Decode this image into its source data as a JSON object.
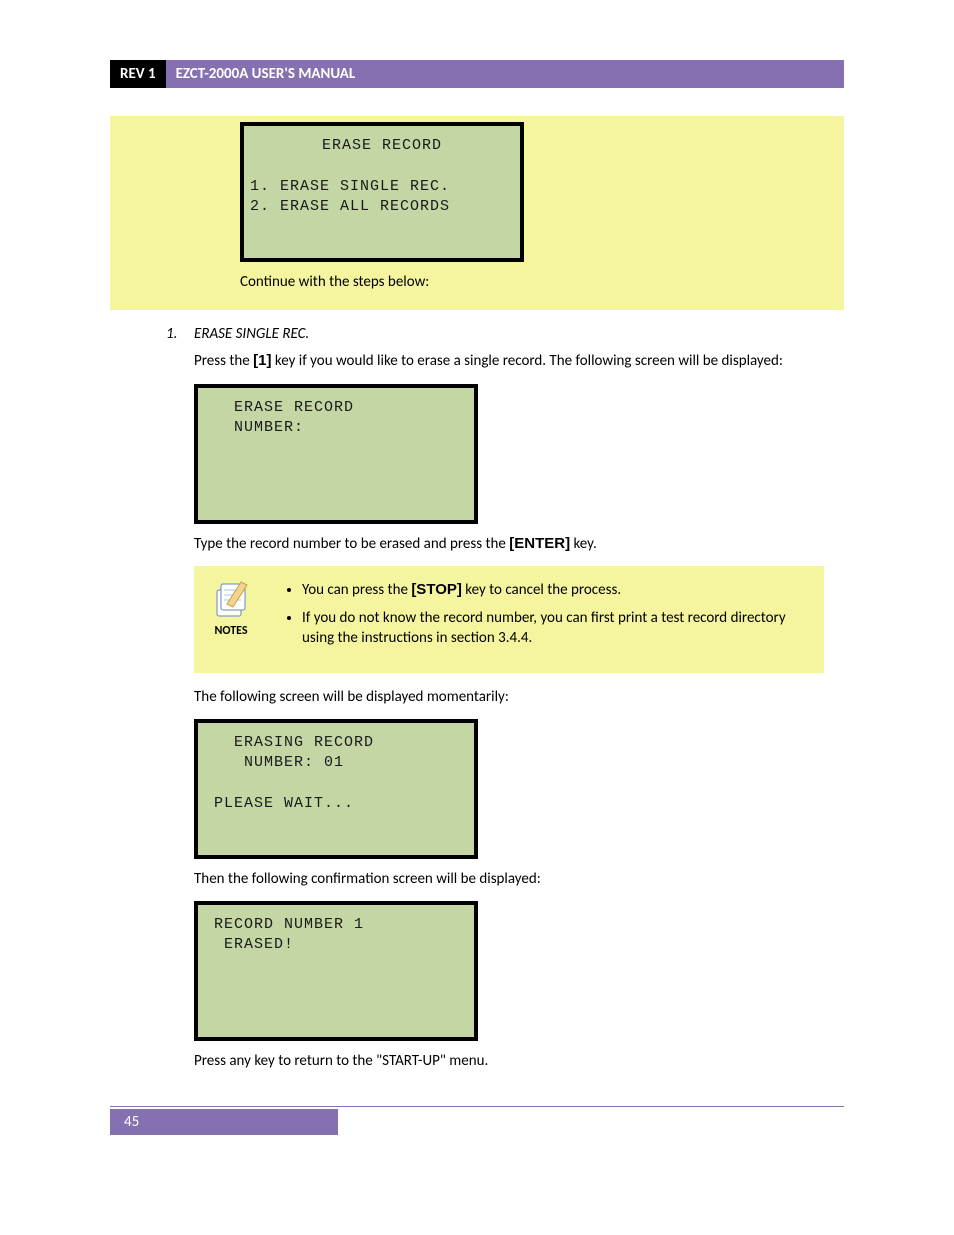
{
  "header": {
    "rev": "REV 1",
    "title": "EZCT-2000A USER'S MANUAL"
  },
  "block1": {
    "lcd_title": "ERASE RECORD",
    "lcd_opt1": "1. ERASE SINGLE REC.",
    "lcd_opt2": "2. ERASE ALL RECORDS",
    "continue": "Continue with the steps below:"
  },
  "step1": {
    "num": "1.",
    "heading": "ERASE SINGLE REC.",
    "p1a": "Press the ",
    "p1_key": "[1]",
    "p1b": " key if you would like to erase a single record. The following screen will be displayed:",
    "lcd2_l1": "ERASE RECORD",
    "lcd2_l2": "NUMBER:",
    "p2a": "Type the record number to be erased and press the ",
    "p2_key": "[ENTER]",
    "p2b": " key.",
    "notes_label": "NOTES",
    "note1a": "You can press the ",
    "note1_key": "[STOP]",
    "note1b": " key to cancel the process.",
    "note2": "If you do not know the record number, you can first print a test record directory using the instructions in section 3.4.4.",
    "p3": "The following screen will be displayed momentarily:",
    "lcd3_l1": "ERASING RECORD",
    "lcd3_l2": " NUMBER: 01",
    "lcd3_l3": "PLEASE WAIT...",
    "p4": "Then the following confirmation screen will be displayed:",
    "lcd4_l1": "RECORD NUMBER 1",
    "lcd4_l2": " ERASED!",
    "p5": "Press any key to return to the \"START-UP\" menu."
  },
  "footer": {
    "page": "45"
  }
}
